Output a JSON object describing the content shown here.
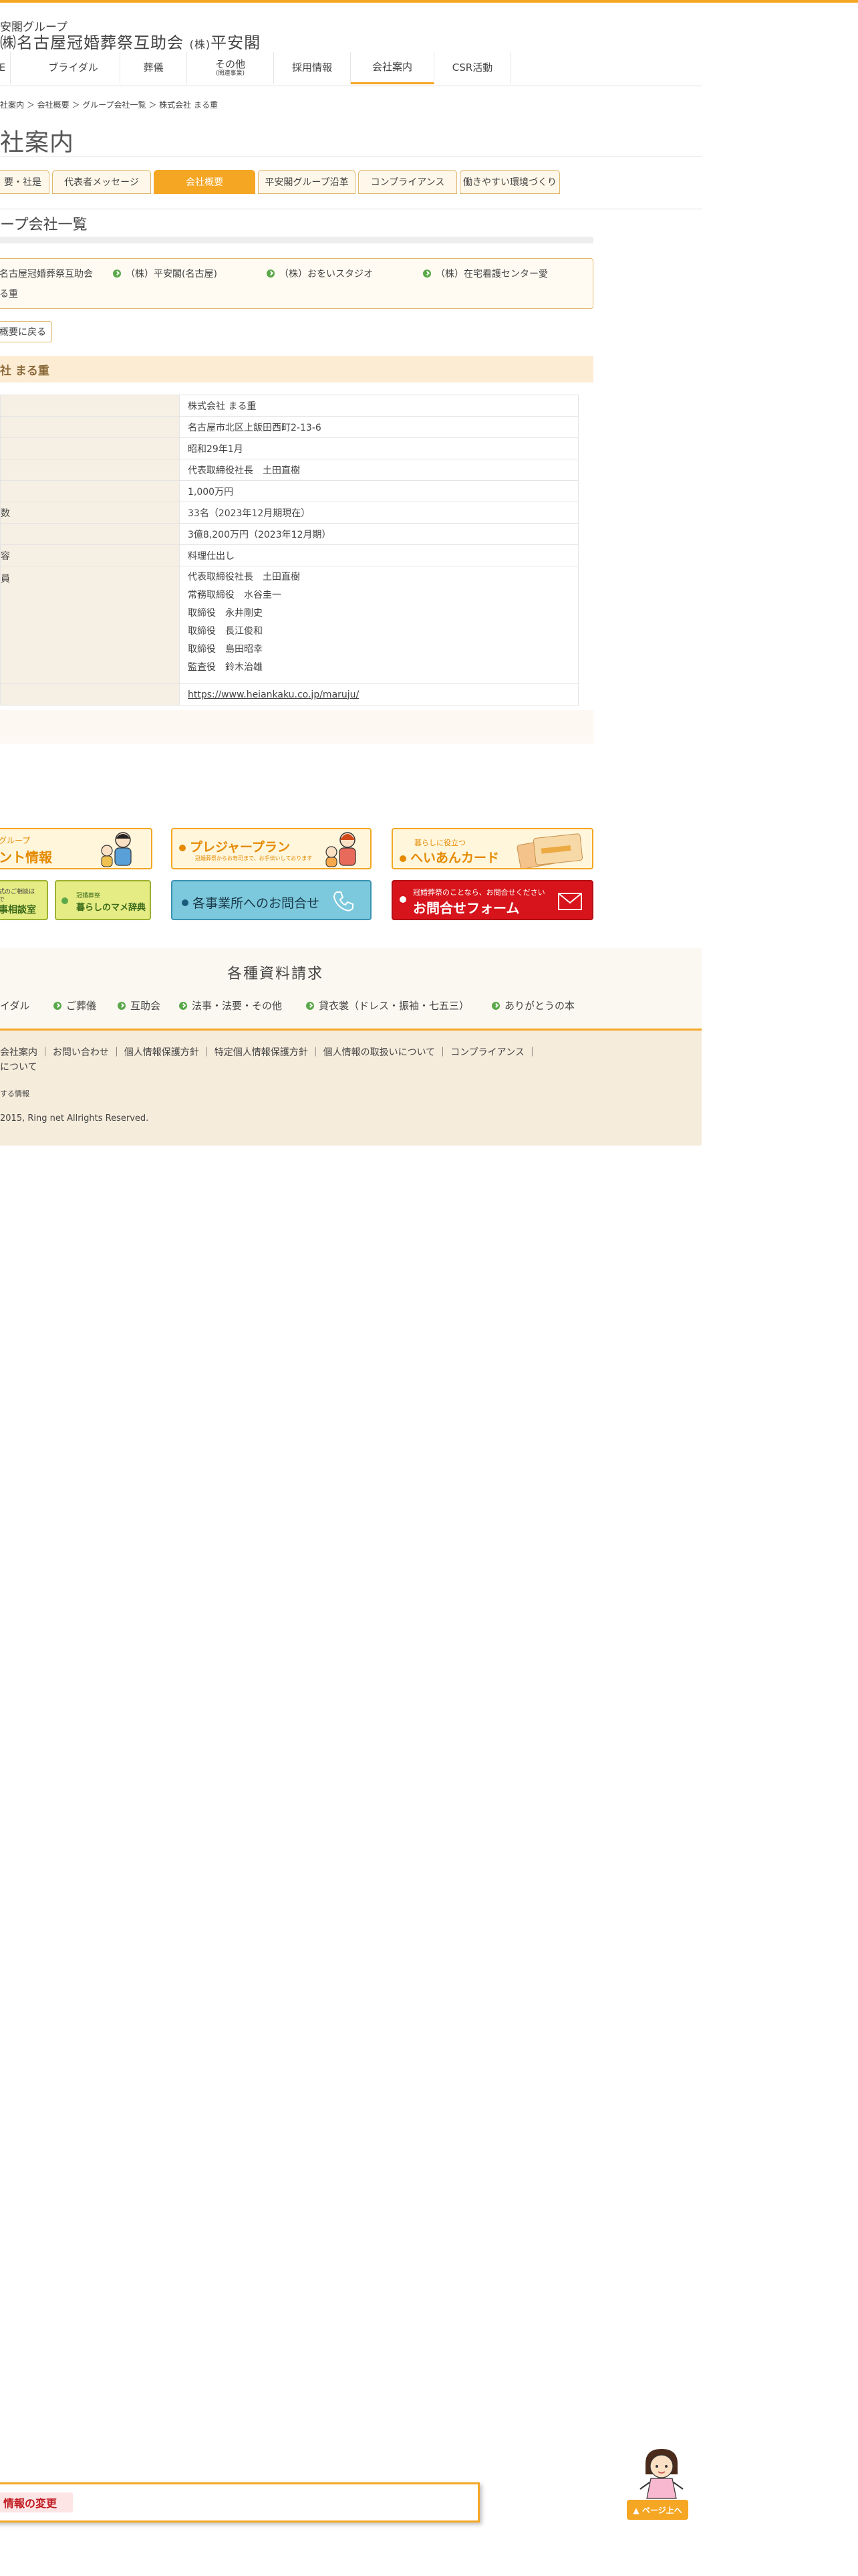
{
  "header": {
    "group": "安閣グループ",
    "company": "㈱名古屋冠婚葬祭互助会",
    "kabu": "(株)",
    "company2": "平安閣"
  },
  "gnav": [
    {
      "label": "E"
    },
    {
      "label": "ブライダル"
    },
    {
      "label": "葬儀"
    },
    {
      "label": "その他",
      "sub": "(関連事業)"
    },
    {
      "label": "採用情報"
    },
    {
      "label": "会社案内"
    },
    {
      "label": "CSR活動"
    }
  ],
  "breadcrumb": "社案内 ＞ 会社概要 ＞ グループ会社一覧 ＞ 株式会社 まる重",
  "page_title": "社案内",
  "tabs": [
    "要・社是",
    "代表者メッセージ",
    "会社概要",
    "平安閣グループ沿革",
    "コンプライアンス",
    "働きやすい環境づくり"
  ],
  "section_title": "ープ会社一覧",
  "group_links": [
    "名古屋冠婚葬祭互助会",
    "（株）平安閣(名古屋)",
    "（株）おをいスタジオ",
    "（株）在宅看護センター愛",
    "る重"
  ],
  "back_label": "概要に戻る",
  "company_head": "社 まる重",
  "info": {
    "labels": [
      "数",
      "容",
      "員"
    ],
    "name": "株式会社 まる重",
    "address": "名古屋市北区上飯田西町2-13-6",
    "founded": "昭和29年1月",
    "representative": "代表取締役社長　土田直樹",
    "capital": "1,000万円",
    "employees": "33名（2023年12月期現在）",
    "sales": "3億8,200万円（2023年12月期）",
    "business": "料理仕出し",
    "officers": [
      "代表取締役社長　土田直樹",
      "常務取締役　水谷圭一",
      "取締役　永井剛史",
      "取締役　長江俊和",
      "取締役　島田昭幸",
      "監査役　鈴木治雄"
    ],
    "url": "https://www.heiankaku.co.jp/maruju/"
  },
  "banners": {
    "event_small": "グループ",
    "event_main": "ント情報",
    "pleasure_main": "プレジャープラン",
    "pleasure_sub": "冠婚葬祭からお寿司まで、お手伝いしております",
    "card_small": "暮らしに役立つ",
    "card_main": "へいあんカード",
    "consult_small1": "式のご相談は",
    "consult_small2": "で",
    "consult_main": "事相談室",
    "dict_small": "冠婚葬祭",
    "dict_main": "暮らしのマメ辞典",
    "office_main": "各事業所へのお問合せ",
    "form_small": "冠婚葬祭のことなら、お問合せください",
    "form_main": "お問合せフォーム"
  },
  "docs": {
    "title": "各種資料請求",
    "items": [
      "イダル",
      "ご葬儀",
      "互助会",
      "法事・法要・その他",
      "貸衣裳（ドレス・振袖・七五三）",
      "ありがとうの本"
    ]
  },
  "footer": {
    "line1": "会社案内 ｜ お問い合わせ ｜ 個人情報保護方針 ｜ 特定個人情報保護方針 ｜ 個人情報の取扱いについて ｜ コンプライアンス ｜",
    "line2": "について",
    "line3": "する情報",
    "copyright": "2015, Ring net Allrights Reserved."
  },
  "float_bar": {
    "tag": "情報の変更"
  },
  "pagetop": "▲ ページ上へ",
  "colors": {
    "accent": "#f5a623",
    "tab_bg": "#fff8ea",
    "key_bg": "#f6efe3",
    "red": "#d7141b"
  }
}
